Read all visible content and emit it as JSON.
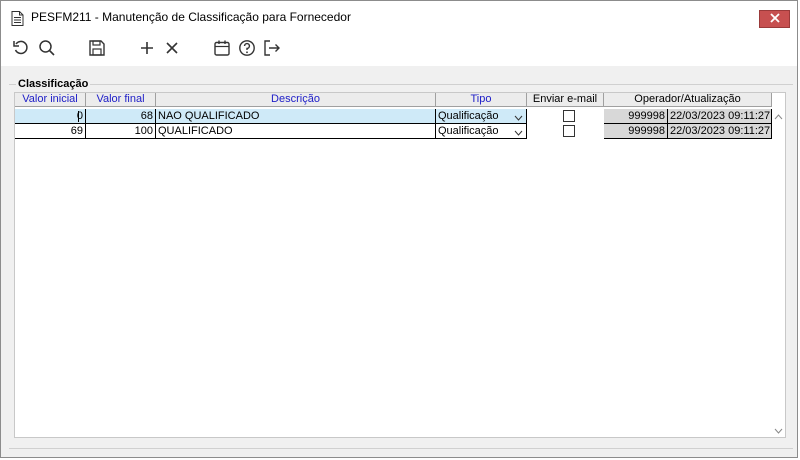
{
  "window": {
    "title": "PESFM211 - Manutenção de Classificação para Fornecedor"
  },
  "toolbar": {
    "buttons": [
      "undo-icon",
      "search-icon",
      "save-icon",
      "add-icon",
      "delete-icon",
      "calendar-icon",
      "help-icon",
      "exit-icon"
    ]
  },
  "group": {
    "label": "Classificação"
  },
  "grid": {
    "columns": {
      "valor_inicial": "Valor inicial",
      "valor_final": "Valor final",
      "descricao": "Descrição",
      "tipo": "Tipo",
      "enviar_email": "Enviar e-mail",
      "operador": "Operador/Atualização"
    },
    "rows": [
      {
        "valor_inicial": "0",
        "valor_final": "68",
        "descricao": "NAO QUALIFICADO",
        "tipo": "Qualificação",
        "enviar_email": false,
        "operador": "999998",
        "atualizacao": "22/03/2023 09:11:27"
      },
      {
        "valor_inicial": "69",
        "valor_final": "100",
        "descricao": "QUALIFICADO",
        "tipo": "Qualificação",
        "enviar_email": false,
        "operador": "999998",
        "atualizacao": "22/03/2023 09:11:27"
      }
    ]
  },
  "colors": {
    "selected_row": "#cfeaf8",
    "header_blue": "#2020c8",
    "close_button": "#c75050"
  }
}
